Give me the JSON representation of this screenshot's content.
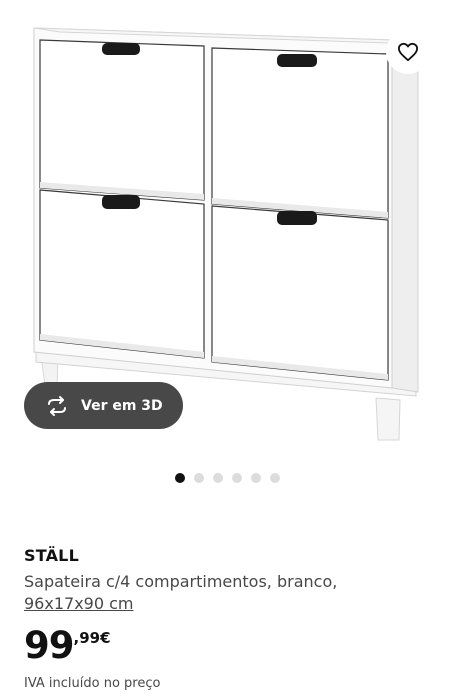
{
  "gallery": {
    "wishlist_icon": "heart-icon",
    "view3d_label": "Ver em 3D",
    "view3d_icon": "rotate-3d-icon",
    "dots_total": 6,
    "dots_active": 1
  },
  "product": {
    "name": "STÄLL",
    "description": "Sapateira c/4 compartimentos, branco,",
    "measurements": "96x17x90 cm",
    "price_integer": "99",
    "price_decimal": ",99€",
    "vat_note": "IVA incluído no preço"
  },
  "colors": {
    "badge_bg": "#484848",
    "dot_active": "#111111",
    "dot_inactive": "#dcdcdc"
  }
}
